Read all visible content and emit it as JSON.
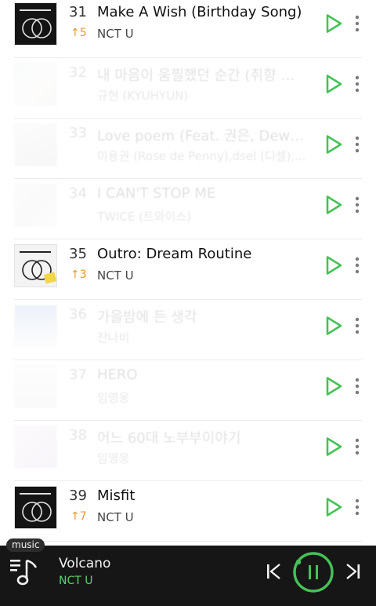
{
  "chart": {
    "rows": [
      {
        "rank": "31",
        "change": "↑5",
        "title": "Make A Wish (Birthday Song)",
        "artist": "NCT U",
        "faded": false
      },
      {
        "rank": "32",
        "change": "",
        "title": "내 마음이 움찔했던 순간 (취향 저격 그녀 X 규현)",
        "artist": "규현 (KYUHYUN)",
        "faded": true
      },
      {
        "rank": "33",
        "change": "",
        "title": "Love poem (Feat. 권은, DewhY) (Prod. dsel)",
        "artist": "이용권 (Rose de Penny),dsel (디셀),...",
        "faded": true
      },
      {
        "rank": "34",
        "change": "",
        "title": "I CAN'T STOP ME",
        "artist": "TWICE (트와이스)",
        "faded": true
      },
      {
        "rank": "35",
        "change": "↑3",
        "title": "Outro: Dream Routine",
        "artist": "NCT U",
        "faded": false
      },
      {
        "rank": "36",
        "change": "",
        "title": "가을밤에 든 생각",
        "artist": "잔나비",
        "faded": true
      },
      {
        "rank": "37",
        "change": "",
        "title": "HERO",
        "artist": "임영웅",
        "faded": true
      },
      {
        "rank": "38",
        "change": "",
        "title": "어느 60대 노부부이야기",
        "artist": "임영웅",
        "faded": true
      },
      {
        "rank": "39",
        "change": "↑7",
        "title": "Misfit",
        "artist": "NCT U",
        "faded": false
      }
    ]
  },
  "player": {
    "tag": "music",
    "title": "Volcano",
    "artist": "NCT U"
  },
  "colors": {
    "accent_green": "#5fd06a",
    "rank_up": "#e8982b",
    "player_bg": "#161616"
  },
  "icons": {
    "row_play": "play-icon",
    "row_more": "more-vertical-icon",
    "player_list": "playlist-music-icon",
    "player_prev": "skip-previous-icon",
    "player_pause": "pause-icon",
    "player_next": "skip-next-icon"
  }
}
